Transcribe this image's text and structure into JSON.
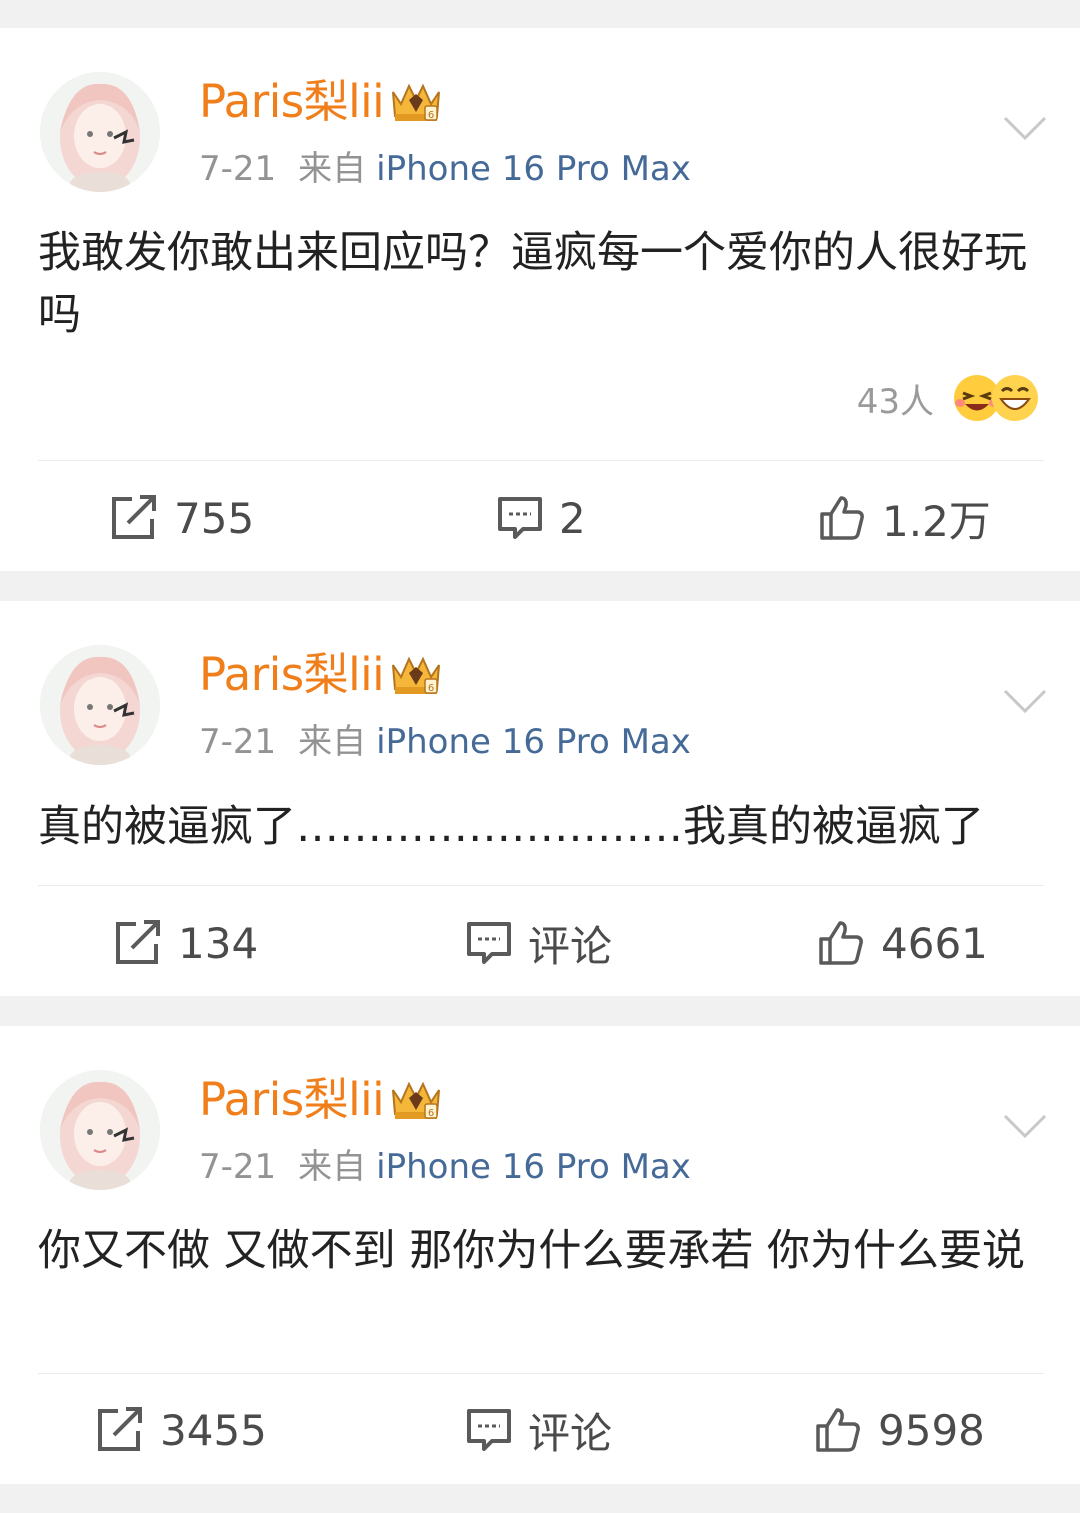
{
  "posts": [
    {
      "author": "Paris梨lii",
      "date": "7-21",
      "source_prefix": "来自",
      "device": "iPhone 16 Pro Max",
      "text": "我敢发你敢出来回应吗？逼疯每一个爱你的人很好玩吗",
      "reactions": "43人",
      "repost": "755",
      "comment": "2",
      "like": "1.2万"
    },
    {
      "author": "Paris梨lii",
      "date": "7-21",
      "source_prefix": "来自",
      "device": "iPhone 16 Pro Max",
      "text": "真的被逼疯了………………………我真的被逼疯了",
      "repost": "134",
      "comment": "评论",
      "like": "4661"
    },
    {
      "author": "Paris梨lii",
      "date": "7-21",
      "source_prefix": "来自",
      "device": "iPhone 16 Pro Max",
      "text": "你又不做 又做不到 那你为什么要承若 你为什么要说",
      "repost": "3455",
      "comment": "评论",
      "like": "9598"
    }
  ],
  "icons": {
    "repost": "repost-icon",
    "comment": "comment-icon",
    "like": "thumbs-up-icon",
    "more": "chevron-down-icon",
    "badge": "crown-badge-icon"
  },
  "colors": {
    "author": "#f07f1b",
    "device": "#456a98",
    "meta": "#939393",
    "background": "#f1f1f1"
  }
}
